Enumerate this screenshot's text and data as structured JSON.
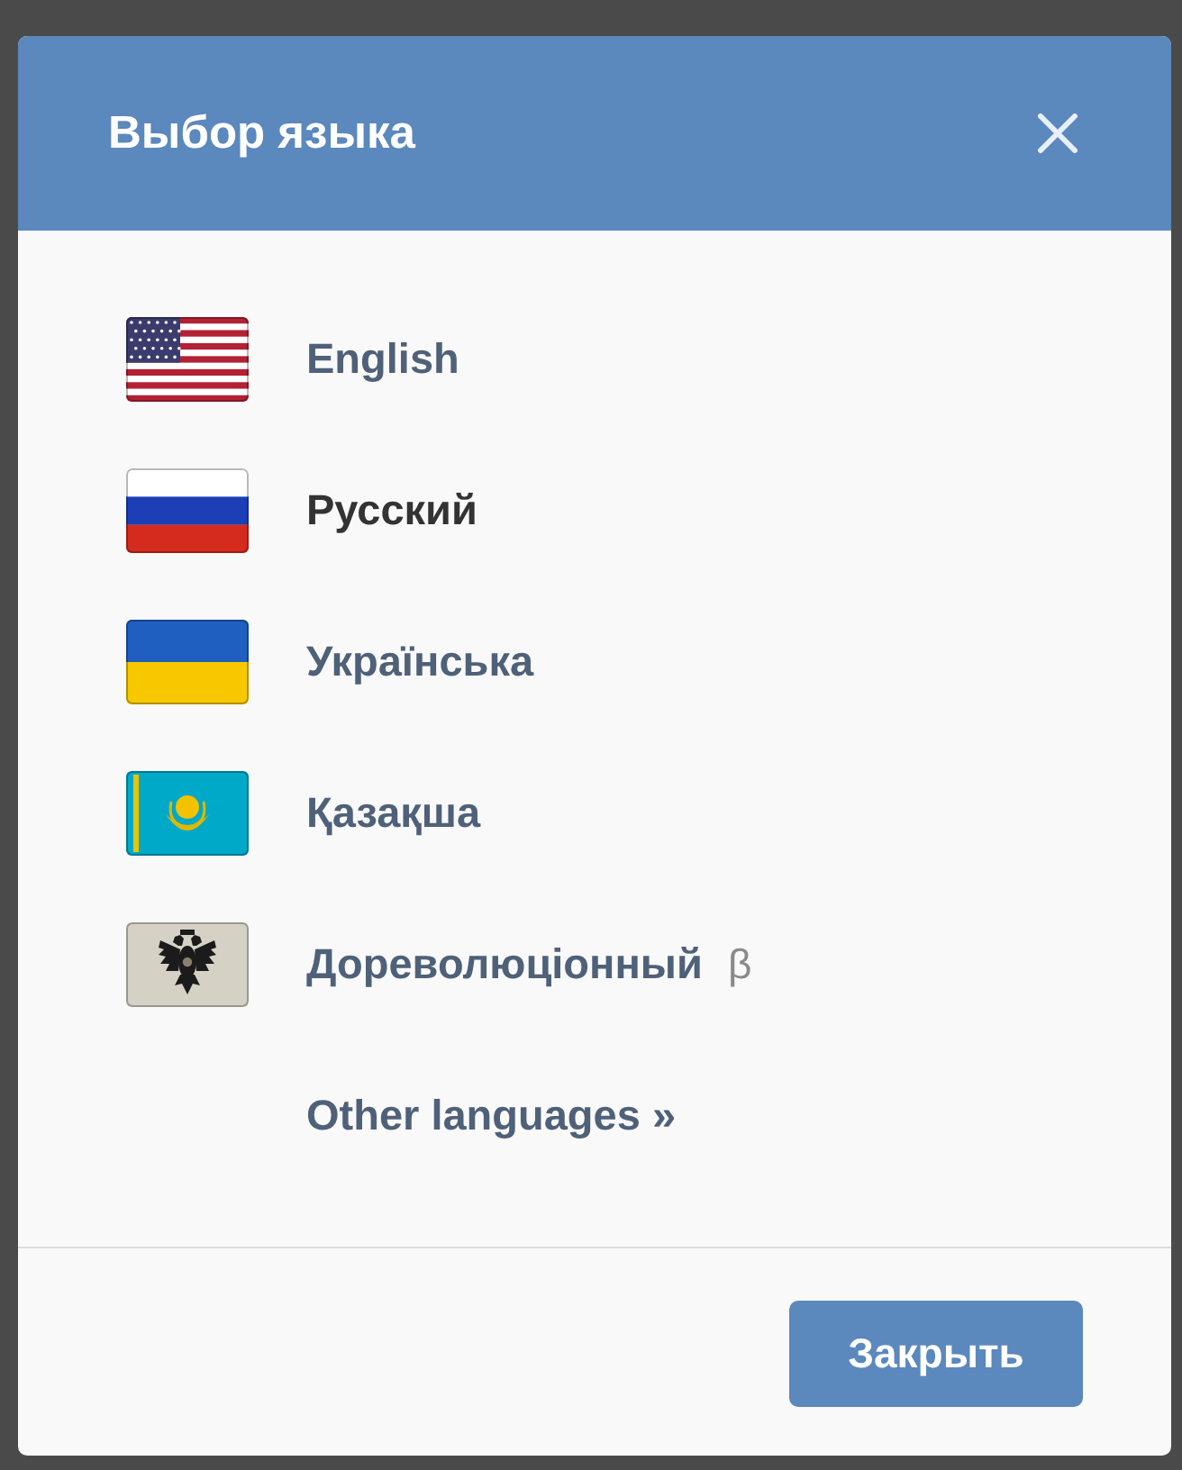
{
  "dialog": {
    "title": "Выбор языка"
  },
  "languages": [
    {
      "label": "English",
      "kind": "us",
      "selected": false
    },
    {
      "label": "Русский",
      "kind": "ru",
      "selected": true
    },
    {
      "label": "Українська",
      "kind": "ua",
      "selected": false
    },
    {
      "label": "Қазақша",
      "kind": "kz",
      "selected": false
    },
    {
      "label": "Дореволюціонный",
      "kind": "imperial",
      "selected": false,
      "badge": "β"
    }
  ],
  "more_link": "Other languages »",
  "buttons": [
    "Закрыть"
  ]
}
